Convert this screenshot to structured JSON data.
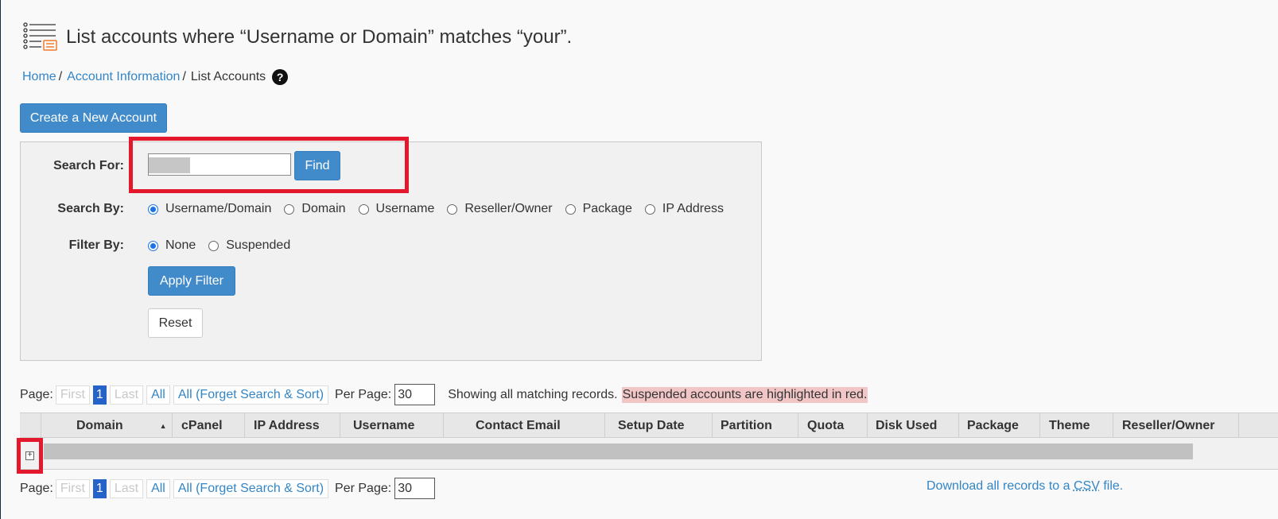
{
  "header": {
    "title": "List accounts where “Username or Domain” matches “your”."
  },
  "breadcrumb": {
    "home": "Home",
    "account_info": "Account Information",
    "current": "List Accounts",
    "sep": "/",
    "help": "?"
  },
  "create_button": "Create a New Account",
  "search": {
    "label": "Search For:",
    "find_button": "Find",
    "search_by_label": "Search By:",
    "search_by_options": [
      "Username/Domain",
      "Domain",
      "Username",
      "Reseller/Owner",
      "Package",
      "IP Address"
    ],
    "search_by_selected": "Username/Domain",
    "filter_by_label": "Filter By:",
    "filter_options": [
      "None",
      "Suspended"
    ],
    "filter_selected": "None",
    "apply_button": "Apply Filter",
    "reset_button": "Reset"
  },
  "pager": {
    "label": "Page:",
    "first": "First",
    "current": "1",
    "last": "Last",
    "all": "All",
    "forget": "All (Forget Search & Sort)",
    "per_page_label": "Per Page:",
    "per_page_value": "30",
    "status": "Showing all matching records.",
    "suspended_note": "Suspended accounts are highlighted in red."
  },
  "table": {
    "columns": [
      "Domain",
      "cPanel",
      "IP Address",
      "Username",
      "Contact Email",
      "Setup Date",
      "Partition",
      "Quota",
      "Disk Used",
      "Package",
      "Theme",
      "Reseller/Owner"
    ],
    "sort_indicator": "▲"
  },
  "download": {
    "prefix": "Download all records to a ",
    "csv": "CSV",
    "suffix": " file."
  },
  "colors": {
    "primary": "#428bca",
    "link": "#3385c6",
    "highlight": "#e3182d",
    "suspended_bg": "#f2c6c6"
  }
}
